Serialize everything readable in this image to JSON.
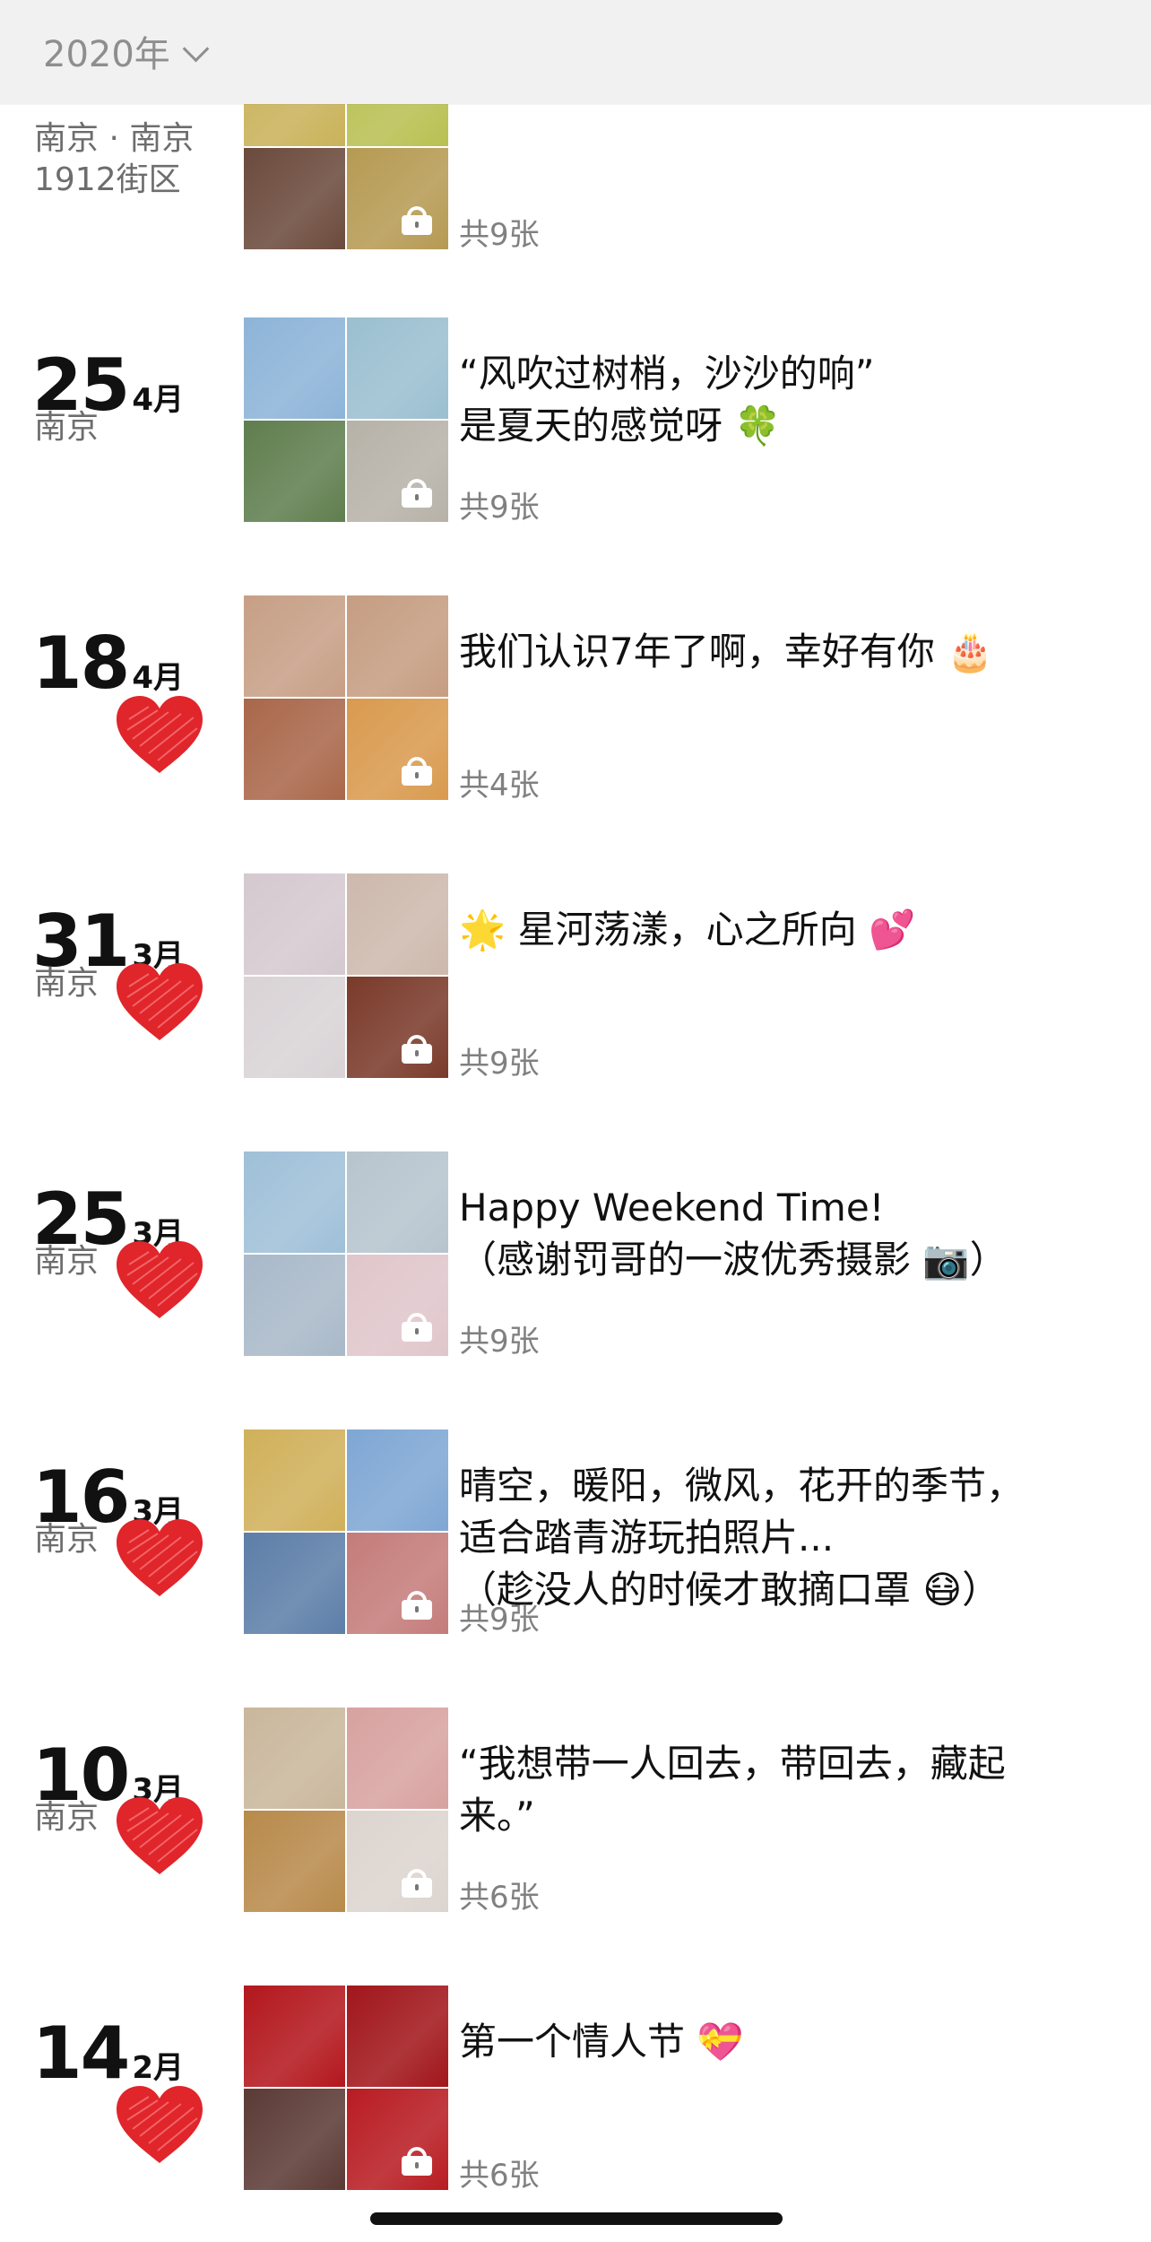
{
  "header": {
    "year_label": "2020年"
  },
  "entries": [
    {
      "day": "",
      "month": "",
      "location": "南京 · 南京\n1912街区",
      "heart": false,
      "text": "",
      "count": "共9张",
      "photos": [
        "#c9b25a",
        "#b9c052",
        "#6b4a3c",
        "#b69a53"
      ]
    },
    {
      "day": "25",
      "month": "4月",
      "location": "南京",
      "heart": false,
      "text": "“风吹过树梢，沙沙的响”\n是夏天的感觉呀 🍀",
      "count": "共9张",
      "photos": [
        "#8db4d8",
        "#9bbfd0",
        "#5f7e4e",
        "#b7b2a8"
      ]
    },
    {
      "day": "18",
      "month": "4月",
      "location": "",
      "heart": true,
      "text": "我们认识7年了啊，幸好有你 🎂",
      "count": "共4张",
      "photos": [
        "#c79f86",
        "#c59d82",
        "#a9674a",
        "#d99a4e"
      ]
    },
    {
      "day": "31",
      "month": "3月",
      "location": "南京",
      "heart": true,
      "text": "🌟 星河荡漾，心之所向 💕",
      "count": "共9张",
      "photos": [
        "#d4c9cf",
        "#cdb9ad",
        "#d9d3d6",
        "#7a3a2a"
      ]
    },
    {
      "day": "25",
      "month": "3月",
      "location": "南京",
      "heart": true,
      "text": "Happy Weekend Time!\n（感谢罚哥的一波优秀摄影 📷）",
      "count": "共9张",
      "photos": [
        "#9fc0d8",
        "#b7c4ce",
        "#a9b9c9",
        "#e0c6cb"
      ]
    },
    {
      "day": "16",
      "month": "3月",
      "location": "南京",
      "heart": true,
      "text": "晴空，暖阳，微风，花开的季节，\n适合踏青游玩拍照片...\n（趁没人的时候才敢摘口罩 😷）",
      "count": "共9张",
      "photos": [
        "#d0b05a",
        "#7fa7d4",
        "#5d7ea8",
        "#c47c7a"
      ]
    },
    {
      "day": "10",
      "month": "3月",
      "location": "南京",
      "heart": true,
      "text": "“我想带一人回去，带回去，藏起\n来。”",
      "count": "共6张",
      "photos": [
        "#c9b79c",
        "#d7a2a0",
        "#b88a4b",
        "#dcd4cf"
      ]
    },
    {
      "day": "14",
      "month": "2月",
      "location": "",
      "heart": true,
      "text": "第一个情人节 💝",
      "count": "共6张",
      "photos": [
        "#b3171d",
        "#a1161b",
        "#5b3a35",
        "#b81c22"
      ]
    }
  ],
  "colors": {
    "heart": "#e0252b",
    "header_bg": "#f1f1f1",
    "muted": "#8e8e8e"
  }
}
